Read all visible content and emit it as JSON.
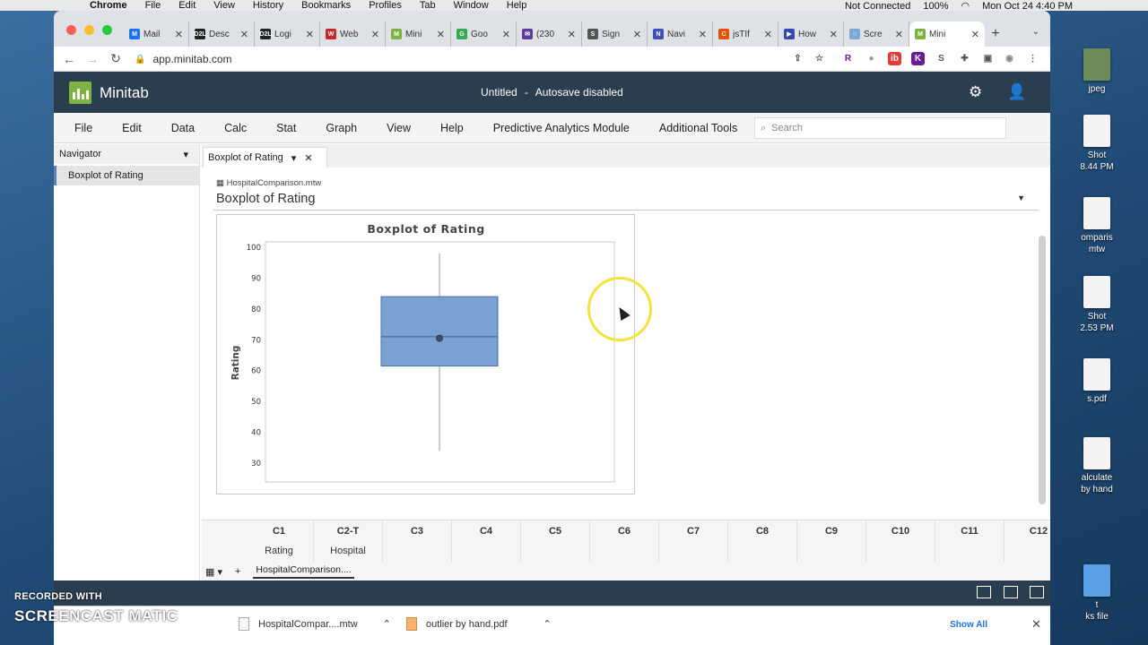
{
  "mac_menu": {
    "items": [
      "Chrome",
      "File",
      "Edit",
      "View",
      "History",
      "Bookmarks",
      "Profiles",
      "Tab",
      "Window",
      "Help"
    ],
    "status": {
      "vpn": "Not Connected",
      "battery": "100%",
      "datetime": "Mon Oct 24  4:40 PM"
    }
  },
  "browser": {
    "tabs": [
      {
        "label": "Mail",
        "fav": "M",
        "color": "#1a73e8"
      },
      {
        "label": "Desc",
        "fav": "D2L",
        "color": "#222222"
      },
      {
        "label": "Logi",
        "fav": "D2L",
        "color": "#222222"
      },
      {
        "label": "Web",
        "fav": "W",
        "color": "#c62828"
      },
      {
        "label": "Mini",
        "fav": "M",
        "color": "#7cb342"
      },
      {
        "label": "Goo",
        "fav": "G",
        "color": "#34a853"
      },
      {
        "label": "(230",
        "fav": "✉",
        "color": "#5c3d99"
      },
      {
        "label": "Sign",
        "fav": "S",
        "color": "#555555"
      },
      {
        "label": "Navi",
        "fav": "N",
        "color": "#3f51b5"
      },
      {
        "label": "jsTIf",
        "fav": "C",
        "color": "#e65100"
      },
      {
        "label": "How",
        "fav": "▶",
        "color": "#3949ab"
      },
      {
        "label": "Scre",
        "fav": "○",
        "color": "#7aa9d6"
      },
      {
        "label": "Mini",
        "fav": "M",
        "color": "#7cb342",
        "active": true
      }
    ],
    "url": "app.minitab.com"
  },
  "app": {
    "name": "Minitab",
    "doc_title": "Untitled",
    "autosave": "Autosave disabled",
    "menu": [
      "File",
      "Edit",
      "Data",
      "Calc",
      "Stat",
      "Graph",
      "View",
      "Help",
      "Predictive Analytics Module",
      "Additional Tools"
    ],
    "search_placeholder": "Search",
    "navigator": {
      "title": "Navigator",
      "items": [
        "Boxplot of Rating"
      ]
    },
    "output": {
      "tab_label": "Boxplot of Rating",
      "worksheet_file": "HospitalComparison.mtw",
      "title": "Boxplot of Rating"
    },
    "worksheet": {
      "columns": [
        {
          "id": "C1",
          "name": "Rating"
        },
        {
          "id": "C2-T",
          "name": "Hospital"
        },
        {
          "id": "C3",
          "name": ""
        },
        {
          "id": "C4",
          "name": ""
        },
        {
          "id": "C5",
          "name": ""
        },
        {
          "id": "C6",
          "name": ""
        },
        {
          "id": "C7",
          "name": ""
        },
        {
          "id": "C8",
          "name": ""
        },
        {
          "id": "C9",
          "name": ""
        },
        {
          "id": "C10",
          "name": ""
        },
        {
          "id": "C11",
          "name": ""
        },
        {
          "id": "C12",
          "name": ""
        }
      ],
      "sheet_tab": "HospitalComparison...."
    }
  },
  "chart_data": {
    "type": "boxplot",
    "title": "Boxplot of Rating",
    "ylabel": "Rating",
    "xlabel": "",
    "ylim": [
      30,
      100
    ],
    "yticks": [
      30,
      40,
      50,
      60,
      70,
      80,
      90,
      100
    ],
    "box": {
      "whisker_low": 34,
      "q1": 61.5,
      "median": 71,
      "mean": 70.5,
      "q3": 84,
      "whisker_high": 98
    },
    "box_color": "#7ba1d4"
  },
  "downloads": {
    "items": [
      "HospitalCompar....mtw",
      "outlier by hand.pdf"
    ],
    "show_all": "Show All"
  },
  "desktop": {
    "labels": [
      "jpeg",
      "Shot",
      "8.44 PM",
      "omparis",
      "mtw",
      "Shot",
      "2.53 PM",
      "s.pdf",
      "alculate",
      "by hand",
      "t",
      "ks file"
    ]
  },
  "watermark": {
    "line1": "RECORDED WITH",
    "line2": "SCREENCAST  MATIC"
  }
}
